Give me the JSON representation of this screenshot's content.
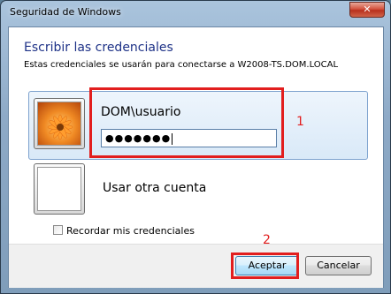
{
  "window": {
    "title": "Seguridad de Windows",
    "close_label": "✕"
  },
  "dialog": {
    "heading": "Escribir las credenciales",
    "subtext": "Estas credenciales se usarán para conectarse a W2008-TS.DOM.LOCAL"
  },
  "credential": {
    "username": "DOM\\usuario",
    "password_mask": "●●●●●●●"
  },
  "other_account": {
    "label": "Usar otra cuenta"
  },
  "remember": {
    "label": "Recordar mis credenciales",
    "checked": false
  },
  "buttons": {
    "ok": "Aceptar",
    "cancel": "Cancelar"
  },
  "annotations": {
    "callout_1": "1",
    "callout_2": "2"
  },
  "colors": {
    "heading": "#1e3287",
    "annotation": "#e21e1e",
    "selected_tile": "#d9e9f8"
  }
}
